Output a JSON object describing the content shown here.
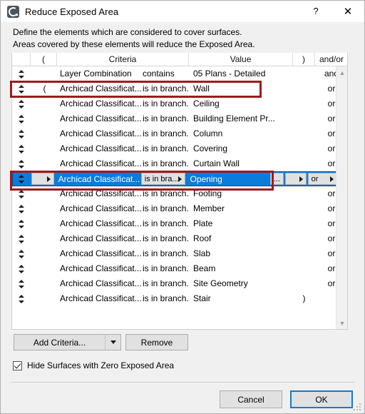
{
  "window": {
    "title": "Reduce Exposed Area",
    "icon": "archicad-logo-icon",
    "help_label": "?",
    "close_label": "✕"
  },
  "description": {
    "line1": "Define the elements which are considered to cover surfaces.",
    "line2": "Areas covered by these elements will reduce the Exposed Area."
  },
  "table": {
    "columns": [
      {
        "key": "sort",
        "label": ""
      },
      {
        "key": "open",
        "label": "("
      },
      {
        "key": "criteria",
        "label": "Criteria"
      },
      {
        "key": "value",
        "label": "Value"
      },
      {
        "key": "close",
        "label": ")"
      },
      {
        "key": "andor",
        "label": "and/or"
      }
    ],
    "rows": [
      {
        "open": "",
        "criteria": "Layer Combination",
        "operator": "contains",
        "value": "05 Plans - Detailed",
        "close": "",
        "andor": "and",
        "selected": false
      },
      {
        "open": "(",
        "criteria": "Archicad Classificat...",
        "operator": "is in branch...",
        "value": "Wall",
        "close": "",
        "andor": "or",
        "selected": false
      },
      {
        "open": "",
        "criteria": "Archicad Classificat...",
        "operator": "is in branch...",
        "value": "Ceiling",
        "close": "",
        "andor": "or",
        "selected": false
      },
      {
        "open": "",
        "criteria": "Archicad Classificat...",
        "operator": "is in branch...",
        "value": "Building Element Pr...",
        "close": "",
        "andor": "or",
        "selected": false
      },
      {
        "open": "",
        "criteria": "Archicad Classificat...",
        "operator": "is in branch...",
        "value": "Column",
        "close": "",
        "andor": "or",
        "selected": false
      },
      {
        "open": "",
        "criteria": "Archicad Classificat...",
        "operator": "is in branch...",
        "value": "Covering",
        "close": "",
        "andor": "or",
        "selected": false
      },
      {
        "open": "",
        "criteria": "Archicad Classificat...",
        "operator": "is in branch...",
        "value": "Curtain Wall",
        "close": "",
        "andor": "or",
        "selected": false
      },
      {
        "open": "",
        "criteria": "Archicad Classificat...",
        "operator": "is in bra...",
        "value": "Opening",
        "close": "",
        "andor": "or",
        "selected": true,
        "ellipsis_label": "..."
      },
      {
        "open": "",
        "criteria": "Archicad Classificat...",
        "operator": "is in branch...",
        "value": "Footing",
        "close": "",
        "andor": "or",
        "selected": false
      },
      {
        "open": "",
        "criteria": "Archicad Classificat...",
        "operator": "is in branch...",
        "value": "Member",
        "close": "",
        "andor": "or",
        "selected": false
      },
      {
        "open": "",
        "criteria": "Archicad Classificat...",
        "operator": "is in branch...",
        "value": "Plate",
        "close": "",
        "andor": "or",
        "selected": false
      },
      {
        "open": "",
        "criteria": "Archicad Classificat...",
        "operator": "is in branch...",
        "value": "Roof",
        "close": "",
        "andor": "or",
        "selected": false
      },
      {
        "open": "",
        "criteria": "Archicad Classificat...",
        "operator": "is in branch...",
        "value": "Slab",
        "close": "",
        "andor": "or",
        "selected": false
      },
      {
        "open": "",
        "criteria": "Archicad Classificat...",
        "operator": "is in branch...",
        "value": "Beam",
        "close": "",
        "andor": "or",
        "selected": false
      },
      {
        "open": "",
        "criteria": "Archicad Classificat...",
        "operator": "is in branch...",
        "value": "Site Geometry",
        "close": "",
        "andor": "or",
        "selected": false
      },
      {
        "open": "",
        "criteria": "Archicad Classificat...",
        "operator": "is in branch...",
        "value": "Stair",
        "close": ")",
        "andor": "",
        "selected": false
      }
    ]
  },
  "scrollbar": {
    "up_label": "▲",
    "down_label": "▼"
  },
  "controls": {
    "add_criteria_label": "Add Criteria...",
    "remove_label": "Remove",
    "hide_surfaces_label": "Hide Surfaces with Zero Exposed Area",
    "hide_surfaces_checked": true
  },
  "footer": {
    "cancel_label": "Cancel",
    "ok_label": "OK"
  },
  "colors": {
    "selection_blue": "#0a7cdb",
    "annotation_red": "#9e1b1b",
    "dialog_bg": "#f0f0f0",
    "button_bg": "#e1e1e1"
  }
}
